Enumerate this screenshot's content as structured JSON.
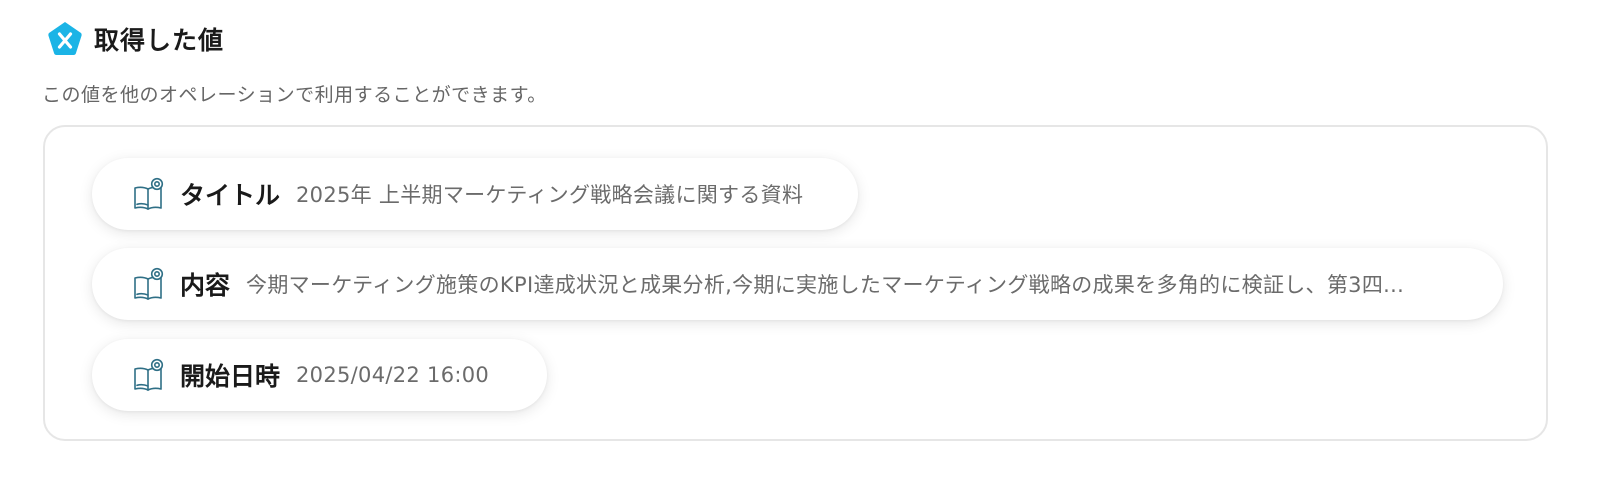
{
  "header": {
    "icon": "x-pentagon-icon",
    "accent_color": "#1bb4e6",
    "title": "取得した値"
  },
  "description": "この値を他のオペレーションで利用することができます。",
  "values": [
    {
      "icon": "book-icon",
      "label": "タイトル",
      "value": "2025年 上半期マーケティング戦略会議に関する資料"
    },
    {
      "icon": "book-icon",
      "label": "内容",
      "value": "今期マーケティング施策のKPI達成状況と成果分析,今期に実施したマーケティング戦略の成果を多角的に検証し、第3四..."
    },
    {
      "icon": "book-icon",
      "label": "開始日時",
      "value": "2025/04/22 16:00"
    }
  ]
}
